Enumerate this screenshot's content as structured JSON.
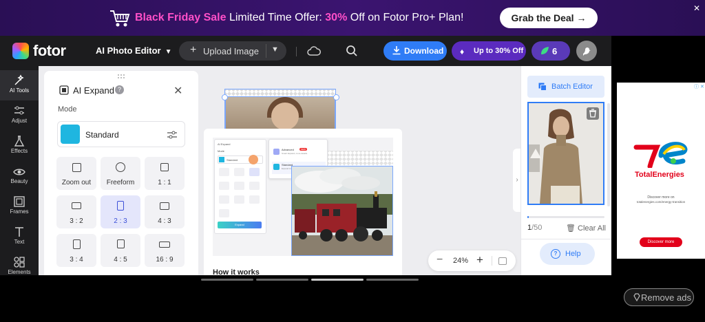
{
  "banner": {
    "sale": "Black Friday Sale",
    "text_mid": " Limited Time Offer: ",
    "discount": "30%",
    "text_end": " Off on Fotor Pro+ Plan!",
    "cta": "Grab the Deal →",
    "close": "✕",
    "icon": "shopping-cart-icon"
  },
  "topbar": {
    "logo": "fotor",
    "editor": "AI Photo Editor",
    "upload": "Upload Image",
    "download": "Download",
    "pro": "Up to 30% Off",
    "credits": "6"
  },
  "rail": [
    {
      "label": "AI Tools",
      "icon": "sparkle-wand-icon",
      "active": true
    },
    {
      "label": "Adjust",
      "icon": "sliders-icon"
    },
    {
      "label": "Effects",
      "icon": "flask-icon"
    },
    {
      "label": "Beauty",
      "icon": "eye-icon"
    },
    {
      "label": "Frames",
      "icon": "frame-icon"
    },
    {
      "label": "Text",
      "icon": "text-icon"
    },
    {
      "label": "Elements",
      "icon": "shapes-icon"
    }
  ],
  "panel": {
    "title": "AI Expand",
    "help": "?",
    "mode_label": "Mode",
    "mode_value": "Standard",
    "ratios": [
      {
        "label": "Zoom out"
      },
      {
        "label": "Freeform"
      },
      {
        "label": "1 : 1"
      },
      {
        "label": "3 : 2"
      },
      {
        "label": "2 : 3",
        "selected": true
      },
      {
        "label": "4 : 3"
      },
      {
        "label": "3 : 4"
      },
      {
        "label": "4 : 5"
      },
      {
        "label": "16 : 9"
      }
    ]
  },
  "canvas": {
    "how_it_works": "How it works",
    "zoom": "24%",
    "mini": {
      "title": "AI Expand",
      "mode": "Mode",
      "standard": "Standard",
      "advanced": "Advanced",
      "advanced_desc": "Smart Expand, more details.",
      "standard_desc": "Expand instantly. Blend Perfectly.",
      "expand": "Expand",
      "new_badge": "NEW"
    }
  },
  "right": {
    "batch": "Batch Editor",
    "count_current": "1",
    "count_total": "/50",
    "progress": 0.02,
    "clear": "Clear All",
    "help": "Help"
  },
  "ad": {
    "brand": "TotalEnergies",
    "line1": "Discover more on",
    "line2": "totalenergies.com/energy-transition",
    "cta": "Discover more",
    "remove": "Remove ads"
  },
  "colors": {
    "accent": "#2f7cf6",
    "promo": "#ff4fc8",
    "pro": "#5b2bbf"
  }
}
